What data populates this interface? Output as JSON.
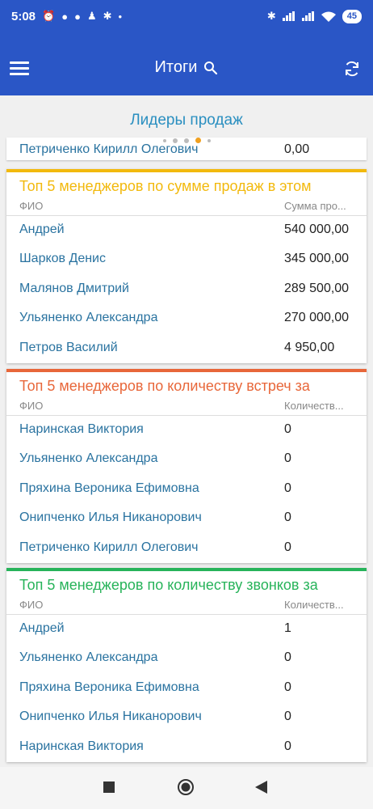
{
  "statusbar": {
    "time": "5:08",
    "battery": "45"
  },
  "appbar": {
    "title": "Итоги"
  },
  "section": {
    "title": "Лидеры продаж"
  },
  "previous_row": {
    "name": "Петриченко Кирилл Олегович",
    "value": "0,00"
  },
  "cards": [
    {
      "title": "Топ 5 менеджеров по сумме продаж в этом",
      "color": "#f2b90d",
      "col1": "ФИО",
      "col2": "Сумма про...",
      "rows": [
        {
          "name": "Андрей",
          "value": "540 000,00"
        },
        {
          "name": "Шарков Денис",
          "value": "345 000,00"
        },
        {
          "name": "Малянов Дмитрий",
          "value": "289 500,00"
        },
        {
          "name": "Ульяненко Александра",
          "value": "270 000,00"
        },
        {
          "name": "Петров Василий",
          "value": "4 950,00"
        }
      ]
    },
    {
      "title": "Топ 5 менеджеров по количеству встреч за",
      "color": "#e8673a",
      "col1": "ФИО",
      "col2": "Количеств...",
      "rows": [
        {
          "name": "Наринская Виктория",
          "value": "0"
        },
        {
          "name": "Ульяненко Александра",
          "value": "0"
        },
        {
          "name": "Пряхина Вероника Ефимовна",
          "value": "0"
        },
        {
          "name": "Онипченко Илья Никанорович",
          "value": "0"
        },
        {
          "name": "Петриченко Кирилл Олегович",
          "value": "0"
        }
      ]
    },
    {
      "title": "Топ 5 менеджеров по количеству звонков за",
      "color": "#27b35a",
      "col1": "ФИО",
      "col2": "Количеств...",
      "rows": [
        {
          "name": "Андрей",
          "value": "1"
        },
        {
          "name": "Ульяненко Александра",
          "value": "0"
        },
        {
          "name": "Пряхина Вероника Ефимовна",
          "value": "0"
        },
        {
          "name": "Онипченко Илья Никанорович",
          "value": "0"
        },
        {
          "name": "Наринская Виктория",
          "value": "0"
        }
      ]
    }
  ],
  "colors": {
    "brand": "#2a56c6",
    "accent_link": "#2a73a0",
    "section_title": "#2a8fc0"
  },
  "icons": [
    "menu-icon",
    "search-icon",
    "refresh-icon",
    "nav-recents-icon",
    "nav-home-icon",
    "nav-back-icon"
  ]
}
